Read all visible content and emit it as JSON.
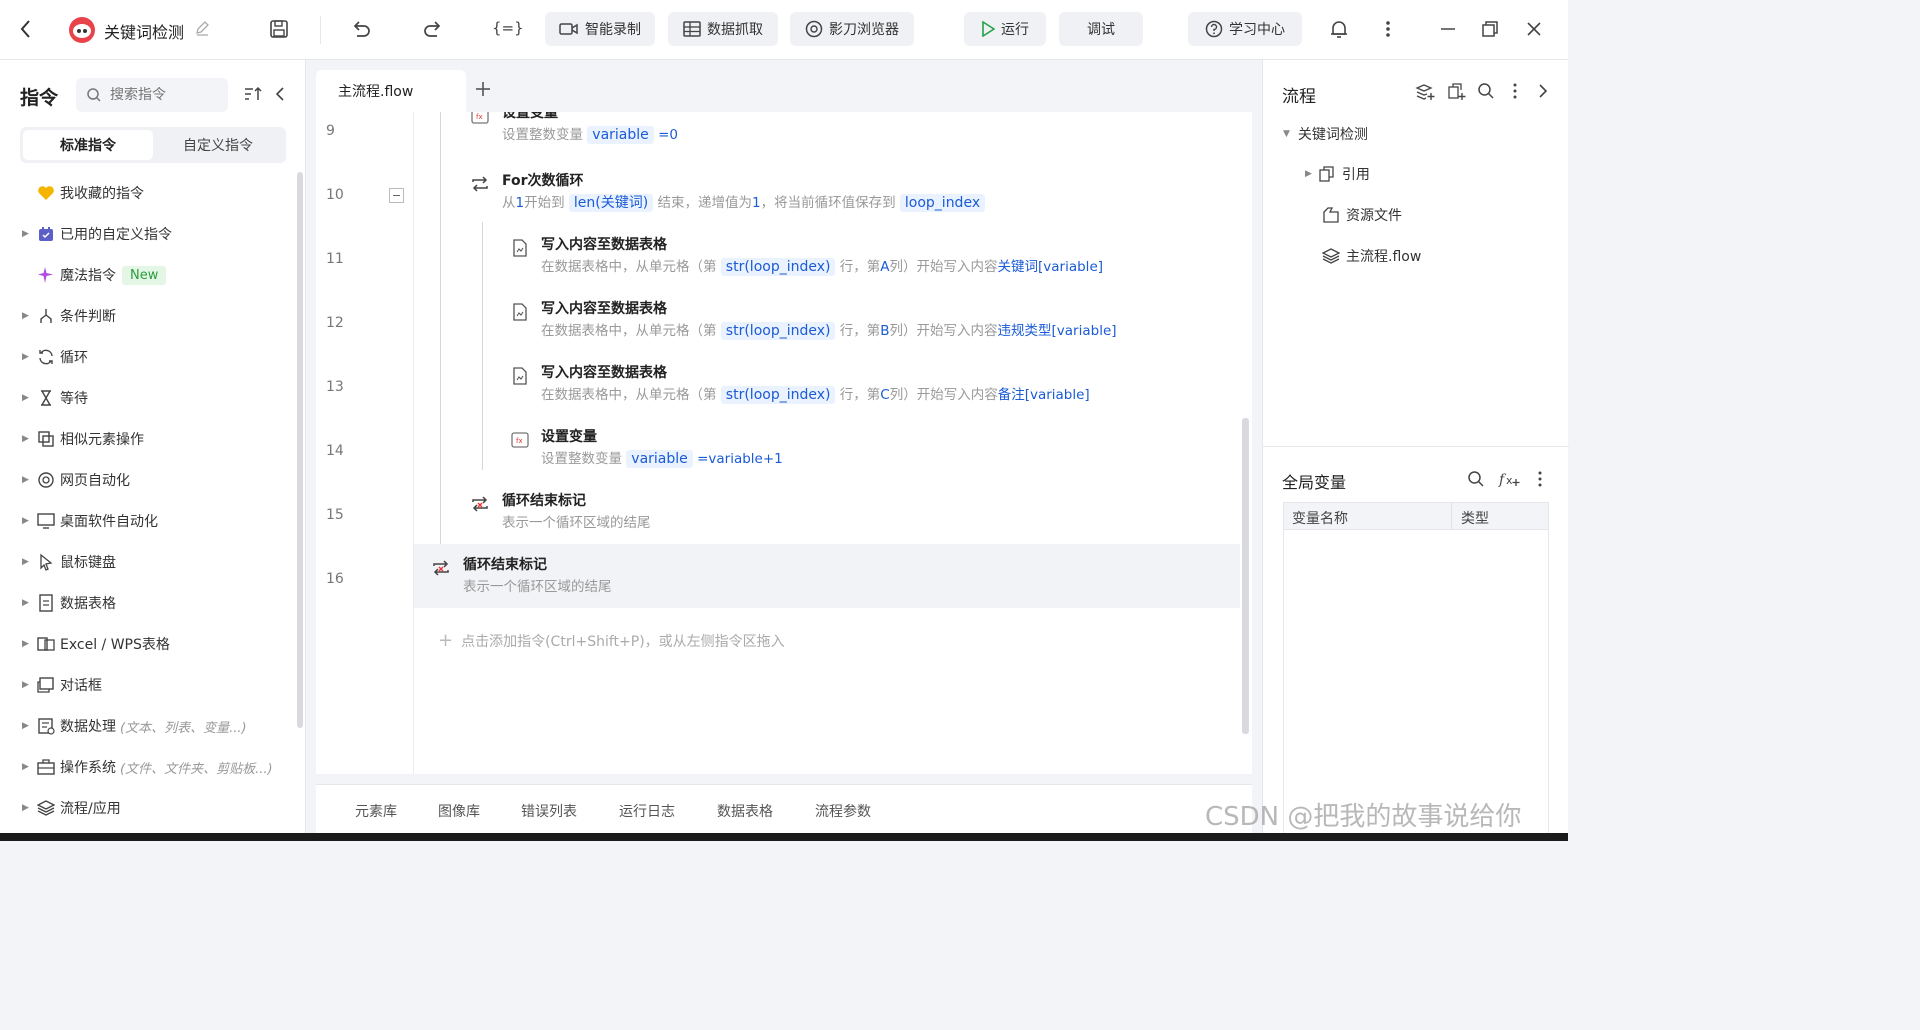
{
  "topbar": {
    "back_icon": "chevron-left-icon",
    "app_title": "关键词检测",
    "record_label": "智能录制",
    "grab_label": "数据抓取",
    "browser_label": "影刀浏览器",
    "run_label": "运行",
    "debug_label": "调试",
    "learn_label": "学习中心"
  },
  "left": {
    "title": "指令",
    "search_placeholder": "搜索指令",
    "tab_standard": "标准指令",
    "tab_custom": "自定义指令",
    "items": [
      {
        "label": "我收藏的指令",
        "icon": "heart-icon",
        "hint": ""
      },
      {
        "label": "已用的自定义指令",
        "icon": "briefcase-icon",
        "hint": ""
      },
      {
        "label": "魔法指令",
        "icon": "sparkle-icon",
        "hint": ""
      },
      {
        "label": "条件判断",
        "icon": "branch-icon",
        "hint": ""
      },
      {
        "label": "循环",
        "icon": "loop-icon",
        "hint": ""
      },
      {
        "label": "等待",
        "icon": "hourglass-icon",
        "hint": ""
      },
      {
        "label": "相似元素操作",
        "icon": "copy-icon",
        "hint": ""
      },
      {
        "label": "网页自动化",
        "icon": "browser-icon",
        "hint": ""
      },
      {
        "label": "桌面软件自动化",
        "icon": "monitor-icon",
        "hint": ""
      },
      {
        "label": "鼠标键盘",
        "icon": "cursor-icon",
        "hint": ""
      },
      {
        "label": "数据表格",
        "icon": "sheet-icon",
        "hint": ""
      },
      {
        "label": "Excel / WPS表格",
        "icon": "excel-icon",
        "hint": ""
      },
      {
        "label": "对话框",
        "icon": "dialog-icon",
        "hint": ""
      },
      {
        "label": "数据处理",
        "icon": "data-icon",
        "hint": "(文本、列表、变量...)"
      },
      {
        "label": "操作系统",
        "icon": "toolbox-icon",
        "hint": "(文件、文件夹、剪贴板...)"
      },
      {
        "label": "流程/应用",
        "icon": "layers-icon",
        "hint": ""
      }
    ],
    "new_badge": "New"
  },
  "center": {
    "tab_label": "主流程.flow",
    "line_numbers": [
      "9",
      "10",
      "11",
      "12",
      "13",
      "14",
      "15",
      "16"
    ],
    "partial_title": "设置变量",
    "line9_desc_prefix": "设置整数变量",
    "line9_var": "variable",
    "line9_val": "=0",
    "for_title": "For次数循环",
    "for_desc": {
      "a": "从",
      "b": "1",
      "c": "开始到",
      "chip1": "len(关键词)",
      "d": "结束，递增值为",
      "e": "1",
      "f": "，将当前循环值保存到",
      "chip2": "loop_index"
    },
    "write_title": "写入内容至数据表格",
    "write_desc_a": "在数据表格中，从单元格（第",
    "write_chip": "str(loop_index)",
    "write_rows": [
      {
        "col_prefix": "行，第",
        "col": "A",
        "col_suffix": "列）开始写入内容",
        "content": "关键词[variable]"
      },
      {
        "col_prefix": "行，第",
        "col": "B",
        "col_suffix": "列）开始写入内容",
        "content": "违规类型[variable]"
      },
      {
        "col_prefix": "行，第",
        "col": "C",
        "col_suffix": "列）开始写入内容",
        "content": "备注[variable]"
      }
    ],
    "set_var_title": "设置变量",
    "set_var_prefix": "设置整数变量",
    "set_var_var": "variable",
    "set_var_val": "=variable+1",
    "loop_end_title": "循环结束标记",
    "loop_end_desc": "表示一个循环区域的结尾",
    "add_hint": "点击添加指令(Ctrl+Shift+P)，或从左侧指令区拖入",
    "bottom_tabs": [
      "元素库",
      "图像库",
      "错误列表",
      "运行日志",
      "数据表格",
      "流程参数"
    ]
  },
  "right": {
    "flow_title": "流程",
    "tree": [
      {
        "label": "关键词检测"
      },
      {
        "label": "引用"
      },
      {
        "label": "资源文件"
      },
      {
        "label": "主流程.flow"
      }
    ],
    "vars_title": "全局变量",
    "col_name": "变量名称",
    "col_type": "类型"
  },
  "watermark": "CSDN @把我的故事说给你"
}
